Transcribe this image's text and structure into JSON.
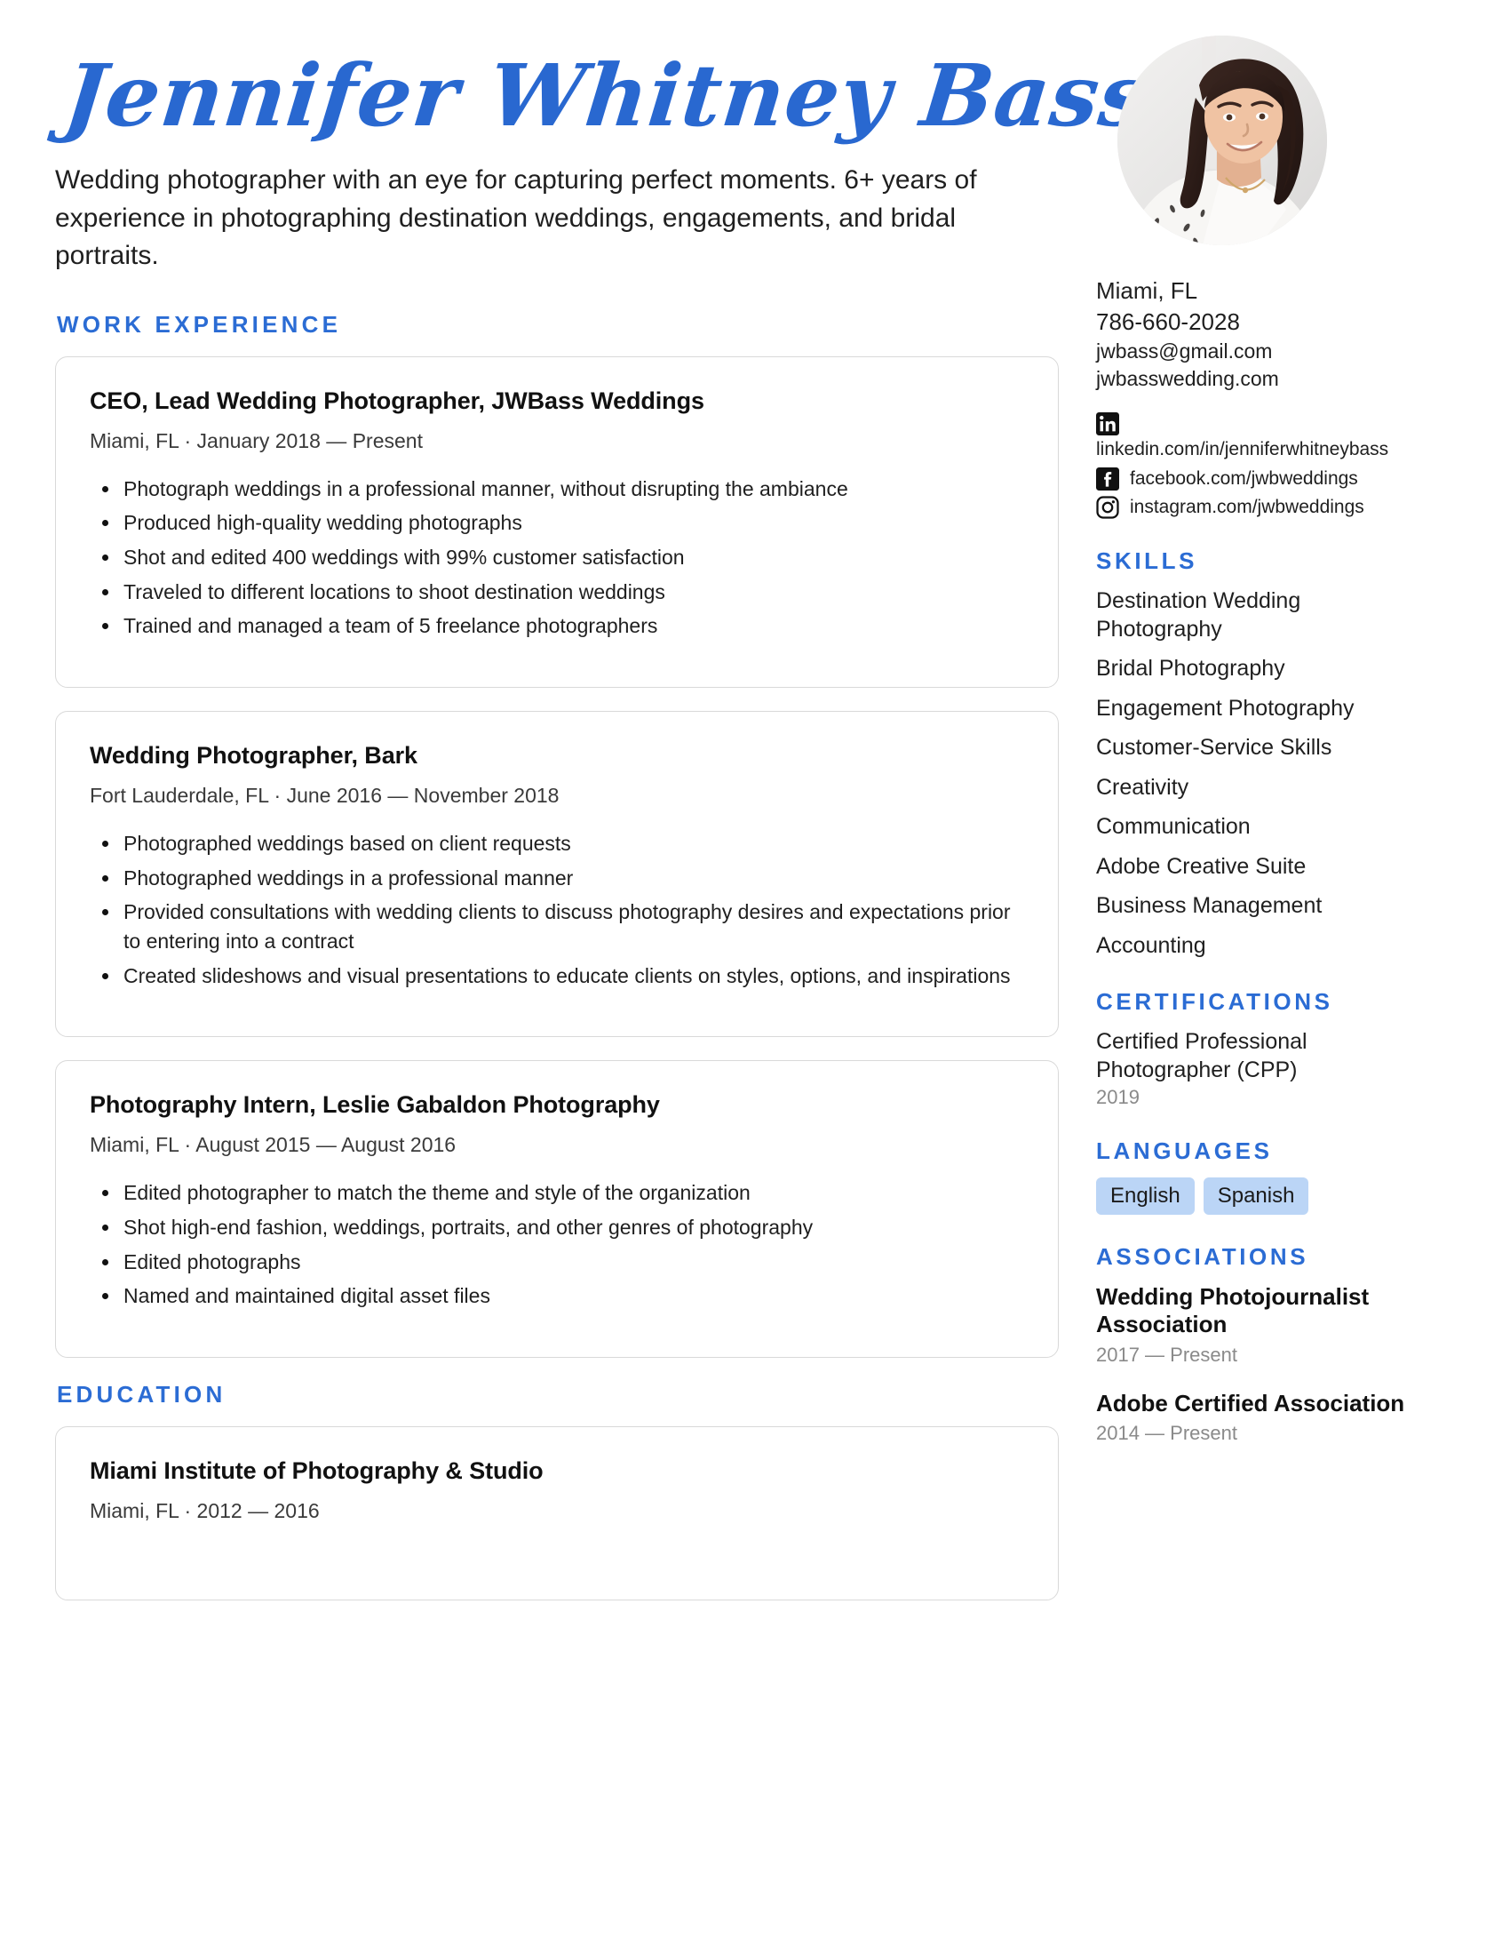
{
  "header": {
    "name": "Jennifer Whitney Bass",
    "summary": "Wedding photographer with an eye for capturing perfect moments. 6+ years of experience in photographing destination weddings, engagements, and bridal portraits.",
    "accent_color": "#2B6CD4",
    "name_color": "#2968D0",
    "avatar_alt": "profile-photo"
  },
  "sections": {
    "work_experience_label": "WORK EXPERIENCE",
    "education_label": "EDUCATION",
    "skills_label": "SKILLS",
    "certifications_label": "CERTIFICATIONS",
    "languages_label": "LANGUAGES",
    "associations_label": "ASSOCIATIONS"
  },
  "work_experience": [
    {
      "title": "CEO, Lead Wedding Photographer, JWBass Weddings",
      "meta": "Miami, FL · January 2018 — Present",
      "bullets": [
        "Photograph weddings in a professional manner, without disrupting the ambiance",
        "Produced high-quality wedding photographs",
        "Shot and edited 400 weddings with 99% customer satisfaction",
        "Traveled to different locations to shoot destination weddings",
        "Trained and managed a team of 5 freelance photographers"
      ]
    },
    {
      "title": "Wedding Photographer, Bark",
      "meta": "Fort Lauderdale, FL · June 2016 — November 2018",
      "bullets": [
        "Photographed weddings based on client requests",
        "Photographed weddings in a professional manner",
        "Provided consultations with wedding clients to discuss photography desires and expectations prior to entering into a contract",
        "Created slideshows and visual presentations to educate clients on styles, options, and inspirations"
      ]
    },
    {
      "title": "Photography Intern, Leslie Gabaldon Photography",
      "meta": "Miami, FL · August 2015 — August 2016",
      "bullets": [
        "Edited photographer to match the theme and style of the organization",
        "Shot high-end fashion, weddings, portraits, and other genres of photography",
        "Edited photographs",
        "Named and maintained digital asset files"
      ]
    }
  ],
  "education": [
    {
      "school": "Miami Institute of Photography & Studio",
      "meta": "Miami, FL · 2012 — 2016"
    }
  ],
  "contact": {
    "location": "Miami, FL",
    "phone": "786-660-2028",
    "email": "jwbass@gmail.com",
    "website": "jwbasswedding.com",
    "socials": [
      {
        "icon": "linkedin-icon",
        "url": "linkedin.com/in/jenniferwhitneybass"
      },
      {
        "icon": "facebook-icon",
        "url": "facebook.com/jwbweddings"
      },
      {
        "icon": "instagram-icon",
        "url": "instagram.com/jwbweddings"
      }
    ]
  },
  "skills": [
    "Destination Wedding Photography",
    "Bridal Photography",
    "Engagement Photography",
    "Customer-Service Skills",
    "Creativity",
    "Communication",
    "Adobe Creative Suite",
    "Business Management",
    "Accounting"
  ],
  "certifications": [
    {
      "name": "Certified Professional Photographer (CPP)",
      "date": "2019"
    }
  ],
  "languages": [
    "English",
    "Spanish"
  ],
  "language_tag_color": "#BBD5F6",
  "associations": [
    {
      "name": "Wedding Photojournalist Association",
      "date": "2017 — Present"
    },
    {
      "name": "Adobe Certified Association",
      "date": "2014 — Present"
    }
  ]
}
